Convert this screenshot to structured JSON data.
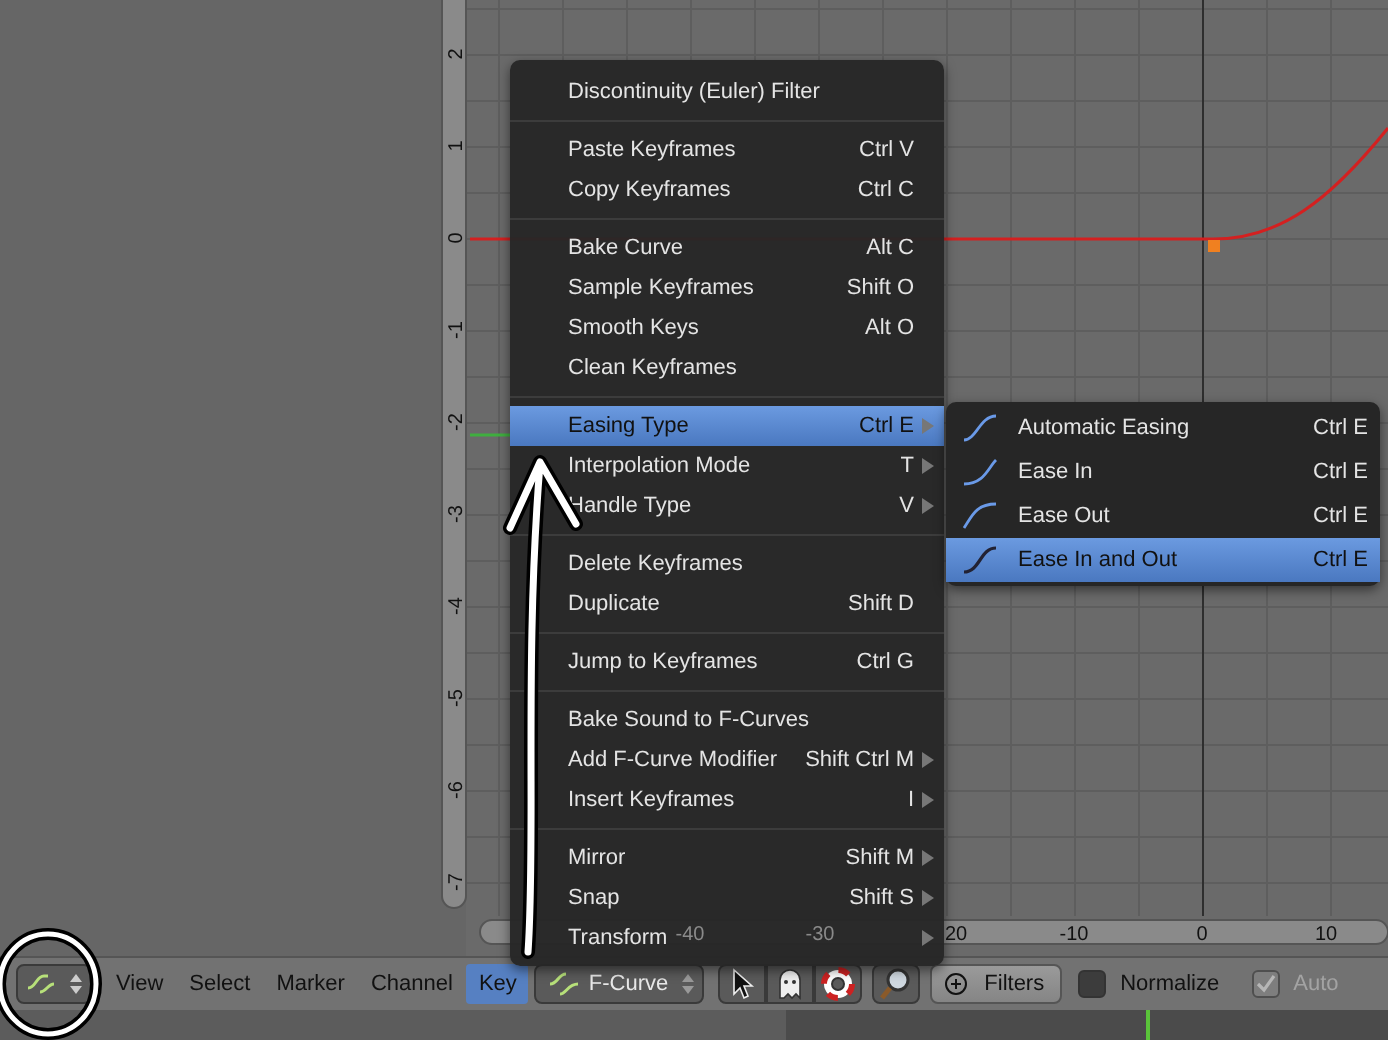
{
  "graph": {
    "y_ruler": [
      "2",
      "1",
      "0",
      "-1",
      "-2",
      "-3",
      "-4",
      "-5",
      "-6",
      "-7"
    ],
    "x_ruler": [
      "-40",
      "-30",
      "20",
      "-10",
      "0",
      "10"
    ]
  },
  "key_menu": {
    "groups": [
      [
        {
          "label": "Discontinuity (Euler) Filter",
          "submenu": false,
          "selected": false
        }
      ],
      [
        {
          "label": "Paste Keyframes",
          "shortcut": "Ctrl V",
          "submenu": false,
          "selected": false
        },
        {
          "label": "Copy Keyframes",
          "shortcut": "Ctrl C",
          "submenu": false,
          "selected": false
        }
      ],
      [
        {
          "label": "Bake Curve",
          "shortcut": "Alt C",
          "submenu": false,
          "selected": false
        },
        {
          "label": "Sample Keyframes",
          "shortcut": "Shift O",
          "submenu": false,
          "selected": false
        },
        {
          "label": "Smooth Keys",
          "shortcut": "Alt O",
          "submenu": false,
          "selected": false
        },
        {
          "label": "Clean Keyframes",
          "submenu": false,
          "selected": false
        }
      ],
      [
        {
          "label": "Easing Type",
          "shortcut": "Ctrl E",
          "submenu": true,
          "selected": true
        },
        {
          "label": "Interpolation Mode",
          "shortcut": "T",
          "submenu": true,
          "selected": false
        },
        {
          "label": "Handle Type",
          "shortcut": "V",
          "submenu": true,
          "selected": false
        }
      ],
      [
        {
          "label": "Delete Keyframes",
          "submenu": false,
          "selected": false
        },
        {
          "label": "Duplicate",
          "shortcut": "Shift D",
          "submenu": false,
          "selected": false
        }
      ],
      [
        {
          "label": "Jump to Keyframes",
          "shortcut": "Ctrl G",
          "submenu": false,
          "selected": false
        }
      ],
      [
        {
          "label": "Bake Sound to F-Curves",
          "submenu": false,
          "selected": false
        },
        {
          "label": "Add F-Curve Modifier",
          "shortcut": "Shift Ctrl M",
          "submenu": true,
          "selected": false
        },
        {
          "label": "Insert Keyframes",
          "shortcut": "I",
          "submenu": true,
          "selected": false
        }
      ],
      [
        {
          "label": "Mirror",
          "shortcut": "Shift M",
          "submenu": true,
          "selected": false
        },
        {
          "label": "Snap",
          "shortcut": "Shift S",
          "submenu": true,
          "selected": false
        },
        {
          "label": "Transform",
          "submenu": true,
          "selected": false
        }
      ]
    ]
  },
  "easing_menu": {
    "items": [
      {
        "kind": "auto",
        "label": "Automatic Easing",
        "shortcut": "Ctrl E",
        "selected": false
      },
      {
        "kind": "in",
        "label": "Ease In",
        "shortcut": "Ctrl E",
        "selected": false
      },
      {
        "kind": "out",
        "label": "Ease Out",
        "shortcut": "Ctrl E",
        "selected": false
      },
      {
        "kind": "in_out",
        "label": "Ease In and Out",
        "shortcut": "Ctrl E",
        "selected": true
      }
    ]
  },
  "header": {
    "menus": [
      {
        "label": "View",
        "selected": false
      },
      {
        "label": "Select",
        "selected": false
      },
      {
        "label": "Marker",
        "selected": false
      },
      {
        "label": "Channel",
        "selected": false
      },
      {
        "label": "Key",
        "selected": true
      }
    ],
    "mode_dropdown": {
      "label": "F-Curve"
    },
    "filters_button": {
      "label": "Filters"
    },
    "normalize": {
      "label": "Normalize",
      "checked": false,
      "disabled": false
    },
    "auto": {
      "label": "Auto",
      "checked": true,
      "disabled": true
    }
  }
}
